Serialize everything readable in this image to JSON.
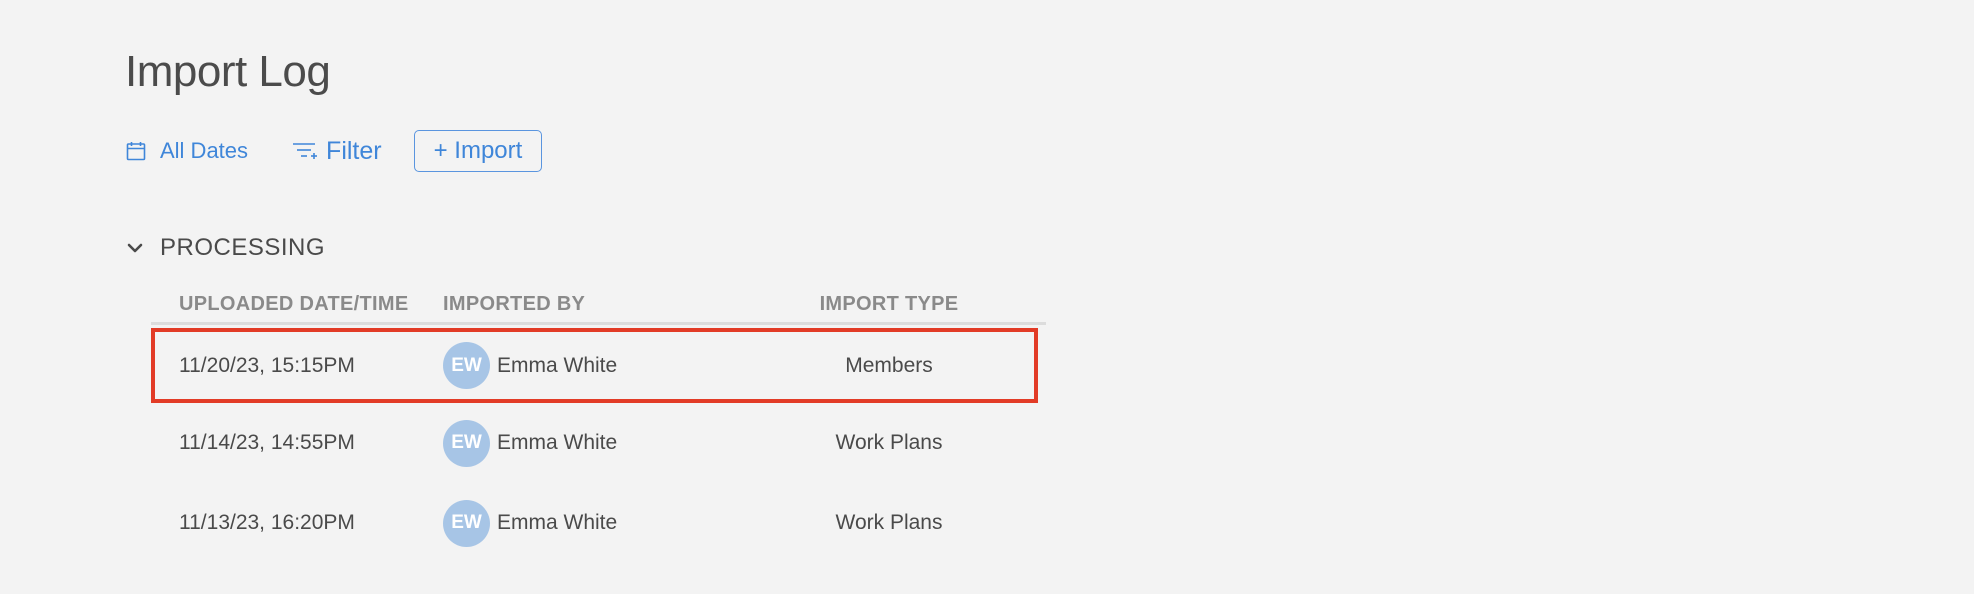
{
  "page": {
    "title": "Import Log"
  },
  "toolbar": {
    "dates_label": "All Dates",
    "filter_label": "Filter",
    "import_label": "+ Import",
    "icons": {
      "dates": "calendar-icon",
      "filter": "filter-icon"
    }
  },
  "section": {
    "title": "PROCESSING",
    "icon": "chevron-down-icon",
    "columns": {
      "date": "UPLOADED DATE/TIME",
      "by": "IMPORTED BY",
      "type": "IMPORT TYPE"
    },
    "rows": [
      {
        "date": "11/20/23, 15:15PM",
        "initials": "EW",
        "name": "Emma White",
        "type": "Members",
        "highlighted": true
      },
      {
        "date": "11/14/23, 14:55PM",
        "initials": "EW",
        "name": "Emma White",
        "type": "Work Plans",
        "highlighted": false
      },
      {
        "date": "11/13/23, 16:20PM",
        "initials": "EW",
        "name": "Emma White",
        "type": "Work Plans",
        "highlighted": false
      }
    ]
  },
  "colors": {
    "accent": "#3f86d9",
    "avatar": "#a7c5e6",
    "highlight": "#e23b26",
    "background": "#f3f3f3"
  }
}
